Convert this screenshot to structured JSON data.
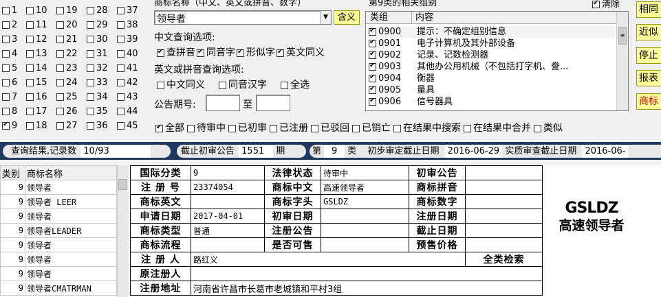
{
  "class_grid": [
    {
      "c": [
        "1",
        "10",
        "19",
        "28",
        "37"
      ],
      "on": [
        false,
        false,
        false,
        false,
        false
      ]
    },
    {
      "c": [
        "2",
        "11",
        "20",
        "29",
        "38"
      ],
      "on": [
        false,
        false,
        false,
        false,
        false
      ]
    },
    {
      "c": [
        "3",
        "12",
        "21",
        "30",
        "39"
      ],
      "on": [
        false,
        false,
        false,
        false,
        false
      ]
    },
    {
      "c": [
        "4",
        "13",
        "22",
        "31",
        "40"
      ],
      "on": [
        false,
        false,
        false,
        false,
        false
      ]
    },
    {
      "c": [
        "5",
        "14",
        "23",
        "32",
        "41"
      ],
      "on": [
        false,
        false,
        false,
        false,
        false
      ]
    },
    {
      "c": [
        "6",
        "15",
        "24",
        "33",
        "42"
      ],
      "on": [
        false,
        false,
        false,
        false,
        false
      ]
    },
    {
      "c": [
        "7",
        "16",
        "25",
        "34",
        "43"
      ],
      "on": [
        false,
        false,
        false,
        false,
        false
      ]
    },
    {
      "c": [
        "8",
        "17",
        "26",
        "35",
        "44"
      ],
      "on": [
        false,
        false,
        false,
        false,
        false
      ]
    },
    {
      "c": [
        "9",
        "18",
        "27",
        "36",
        "45"
      ],
      "on": [
        true,
        false,
        false,
        false,
        false
      ]
    }
  ],
  "search": {
    "name_label": "商标名称（中文、英文或拼音、数字）",
    "name_value": "领导者",
    "meaning_button": "含义",
    "cn_options_label": "中文查询选项:",
    "cn_options": [
      {
        "label": "查拼音",
        "on": true
      },
      {
        "label": "同音字",
        "on": true
      },
      {
        "label": "形似字",
        "on": true
      },
      {
        "label": "英文同义",
        "on": true
      }
    ],
    "en_options_label": "英文或拼音查询选项:",
    "en_options": [
      {
        "label": "中文同义",
        "on": false
      },
      {
        "label": "同音汉字",
        "on": false
      },
      {
        "label": "全选",
        "on": false
      }
    ],
    "period_label": "公告期号:",
    "period_to": "至"
  },
  "group_panel": {
    "title": "第9类的相关组别",
    "clear_label": "清除",
    "clear_on": true,
    "col_group": "类组",
    "col_content": "内容",
    "rows": [
      {
        "code": "0900",
        "text": "提示：不确定组别信息",
        "on": true
      },
      {
        "code": "0901",
        "text": "电子计算机及其外部设备",
        "on": true
      },
      {
        "code": "0902",
        "text": "记录、记数检测器",
        "on": true
      },
      {
        "code": "0903",
        "text": "其他办公用机械（不包括打字机、誊...",
        "on": true
      },
      {
        "code": "0904",
        "text": "衡器",
        "on": true
      },
      {
        "code": "0905",
        "text": "量具",
        "on": true
      },
      {
        "code": "0906",
        "text": "信号器具",
        "on": true
      }
    ]
  },
  "side_buttons": [
    "相同",
    "近似",
    "停止",
    "报表",
    "商标"
  ],
  "status_filters": [
    {
      "label": "全部",
      "on": true
    },
    {
      "label": "待审中",
      "on": false
    },
    {
      "label": "已初审",
      "on": false
    },
    {
      "label": "已注册",
      "on": false
    },
    {
      "label": "已驳回",
      "on": false
    },
    {
      "label": "已销亡",
      "on": false
    },
    {
      "label": "在结果中搜索",
      "on": false
    },
    {
      "label": "在结果中合并",
      "on": false
    },
    {
      "label": "类似",
      "on": false
    }
  ],
  "summary": {
    "result_label": "查询结果,记录数",
    "result_value": "10/93",
    "deadline_label": "截止初审公告",
    "deadline_value": "1551",
    "deadline_unit": "期",
    "class_prefix": "第",
    "class_value": "9",
    "class_suffix": "类",
    "prelim_label": "初步审定截止日期",
    "prelim_value": "2016-06-29",
    "exam_label": "实质审查截止日期",
    "exam_value": "2016-06-"
  },
  "result_list": {
    "col_class": "类别",
    "col_name": "商标名称",
    "rows": [
      {
        "cls": "9",
        "name": "领导者"
      },
      {
        "cls": "9",
        "name": "领导者 LEER"
      },
      {
        "cls": "9",
        "name": "领导者"
      },
      {
        "cls": "9",
        "name": "领导者LEADER"
      },
      {
        "cls": "9",
        "name": "领导者"
      },
      {
        "cls": "9",
        "name": "领导者"
      },
      {
        "cls": "9",
        "name": "领导者"
      },
      {
        "cls": "9",
        "name": "领导者CMATRMAN"
      }
    ]
  },
  "detail": {
    "intl_class_label": "国际分类",
    "intl_class": "9",
    "legal_status_label": "法律状态",
    "legal_status": "待审中",
    "prelim_pub_label": "初审公告",
    "prelim_pub": "",
    "reg_no_label": "注 册 号",
    "reg_no": "23374054",
    "cn_label": "商标中文",
    "cn": "高速领导者",
    "pinyin_label": "商标拼音",
    "pinyin": "",
    "en_label": "商标英文",
    "en": "",
    "initials_label": "商标字头",
    "initials": "GSLDZ",
    "digits_label": "商标数字",
    "digits": "",
    "apply_date_label": "申请日期",
    "apply_date": "2017-04-01",
    "prelim_date_label": "初审日期",
    "prelim_date": "",
    "reg_date_label": "注册日期",
    "reg_date": "",
    "type_label": "商标类型",
    "type": "普通",
    "reg_pub_label": "注册公告",
    "reg_pub": "",
    "end_date_label": "截止日期",
    "end_date": "",
    "flow_label": "商标流程",
    "flow": "",
    "for_sale_label": "是否可售",
    "for_sale": "",
    "presale_label": "预售价格",
    "presale": "",
    "registrant_label": "注 册 人",
    "registrant": "路红义",
    "full_search_label": "全类检索",
    "orig_registrant_label": "原注册人",
    "orig_registrant": "",
    "address_label": "注册地址",
    "address": "河南省许昌市长葛市老城镇和平村3组"
  },
  "logo": {
    "line1": "GSLDZ",
    "line2": "高速领导者"
  }
}
